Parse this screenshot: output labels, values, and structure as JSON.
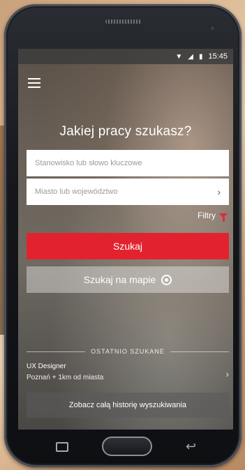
{
  "status_bar": {
    "time": "15:45"
  },
  "header": {
    "headline": "Jakiej pracy szukasz?"
  },
  "search": {
    "position_placeholder": "Stanowisko lub słowo kluczowe",
    "location_placeholder": "Miasto lub województwo",
    "filters_label": "Filtry",
    "search_button": "Szukaj",
    "map_button": "Szukaj na mapie"
  },
  "recent": {
    "section_label": "OSTATNIO SZUKANE",
    "items": [
      {
        "title": "UX Designer",
        "subtitle": "Poznań + 1km od miasta"
      }
    ],
    "history_button": "Zobacz całą historię wyszukiwania"
  },
  "colors": {
    "accent": "#e2232f"
  },
  "icons": {
    "menu": "hamburger-icon",
    "filter": "funnel-icon",
    "map": "location-pin-icon",
    "chevron": "chevron-right-icon"
  }
}
